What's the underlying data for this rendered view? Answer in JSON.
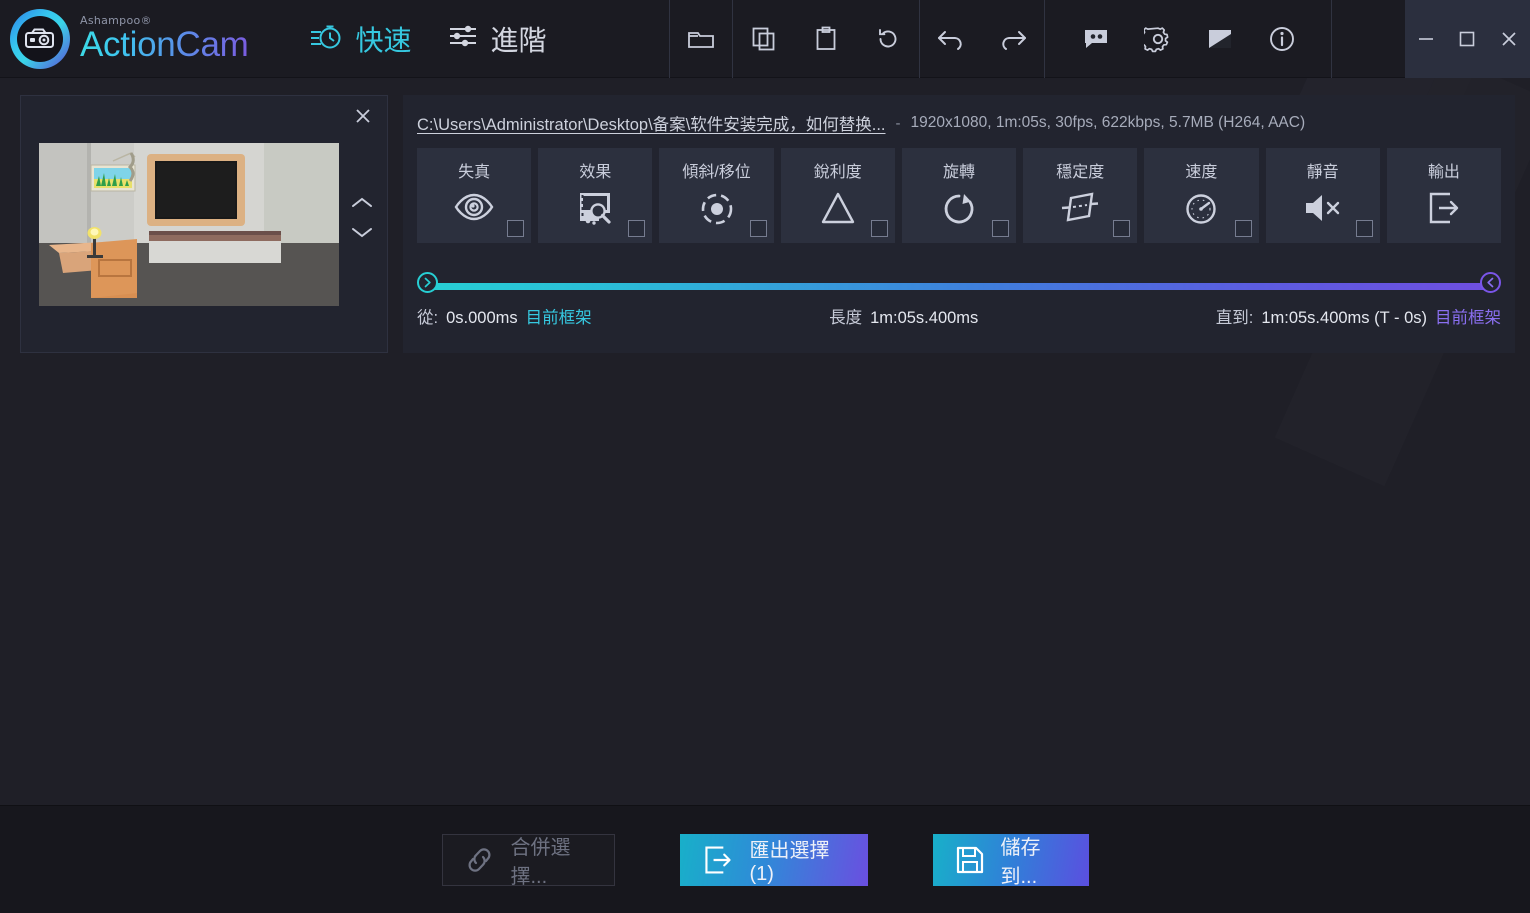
{
  "app": {
    "brand_sup": "Ashampoo®",
    "brand_name": "ActionCam",
    "accent_cyan": "#36c8e0",
    "accent_purple": "#8a6ff0"
  },
  "header": {
    "modes": [
      {
        "label": "快速",
        "icon": "stopwatch-icon",
        "active": true
      },
      {
        "label": "進階",
        "icon": "sliders-icon",
        "active": false
      }
    ],
    "toolbar": [
      {
        "name": "open-folder-button",
        "icon": "folder-icon"
      },
      {
        "name": "copy-button",
        "icon": "copy-icon"
      },
      {
        "name": "paste-button",
        "icon": "clipboard-icon"
      },
      {
        "name": "reset-button",
        "icon": "reset-icon"
      },
      {
        "name": "undo-button",
        "icon": "undo-icon"
      },
      {
        "name": "redo-button",
        "icon": "redo-icon"
      },
      {
        "name": "feedback-button",
        "icon": "feedback-icon"
      },
      {
        "name": "settings-button",
        "icon": "gear-icon"
      },
      {
        "name": "theme-button",
        "icon": "theme-icon"
      },
      {
        "name": "info-button",
        "icon": "info-icon"
      }
    ],
    "window_controls": [
      {
        "name": "minimize-button",
        "icon": "minimize-icon"
      },
      {
        "name": "maximize-button",
        "icon": "maximize-icon"
      },
      {
        "name": "close-button",
        "icon": "close-icon"
      }
    ]
  },
  "clip": {
    "close_icon": "close-icon",
    "move_up_icon": "chevron-up-icon",
    "move_down_icon": "chevron-down-icon"
  },
  "editor": {
    "file_path": "C:\\Users\\Administrator\\Desktop\\备案\\软件安装完成，如何替换...",
    "separator": "-",
    "meta": "1920x1080, 1m:05s, 30fps, 622kbps, 5.7MB (H264, AAC)",
    "effects": [
      {
        "label": "失真",
        "icon": "fisheye-icon",
        "checkbox": true,
        "checked": false
      },
      {
        "label": "效果",
        "icon": "effects-icon",
        "checkbox": true,
        "checked": false
      },
      {
        "label": "傾斜/移位",
        "icon": "tiltshift-icon",
        "checkbox": true,
        "checked": false
      },
      {
        "label": "銳利度",
        "icon": "sharpen-icon",
        "checkbox": true,
        "checked": false
      },
      {
        "label": "旋轉",
        "icon": "rotate-icon",
        "checkbox": true,
        "checked": false
      },
      {
        "label": "穩定度",
        "icon": "stabilize-icon",
        "checkbox": true,
        "checked": false
      },
      {
        "label": "速度",
        "icon": "speed-icon",
        "checkbox": true,
        "checked": false
      },
      {
        "label": "靜音",
        "icon": "mute-icon",
        "checkbox": true,
        "checked": false
      },
      {
        "label": "輸出",
        "icon": "export-icon",
        "checkbox": false,
        "checked": false
      }
    ],
    "timeline": {
      "from_key": "從:",
      "from_value": "0s.000ms",
      "from_link": "目前框架",
      "length_key": "長度",
      "length_value": "1m:05s.400ms",
      "to_key": "直到:",
      "to_value": "1m:05s.400ms (T - 0s)",
      "to_link": "目前框架",
      "left_handle_icon": "chevron-right-icon",
      "right_handle_icon": "chevron-left-icon"
    }
  },
  "bottom": {
    "merge_label": "合併選擇...",
    "merge_icon": "link-icon",
    "export_label": "匯出選擇 (1)",
    "export_icon": "export-icon",
    "save_label": "儲存到...",
    "save_icon": "save-icon"
  }
}
